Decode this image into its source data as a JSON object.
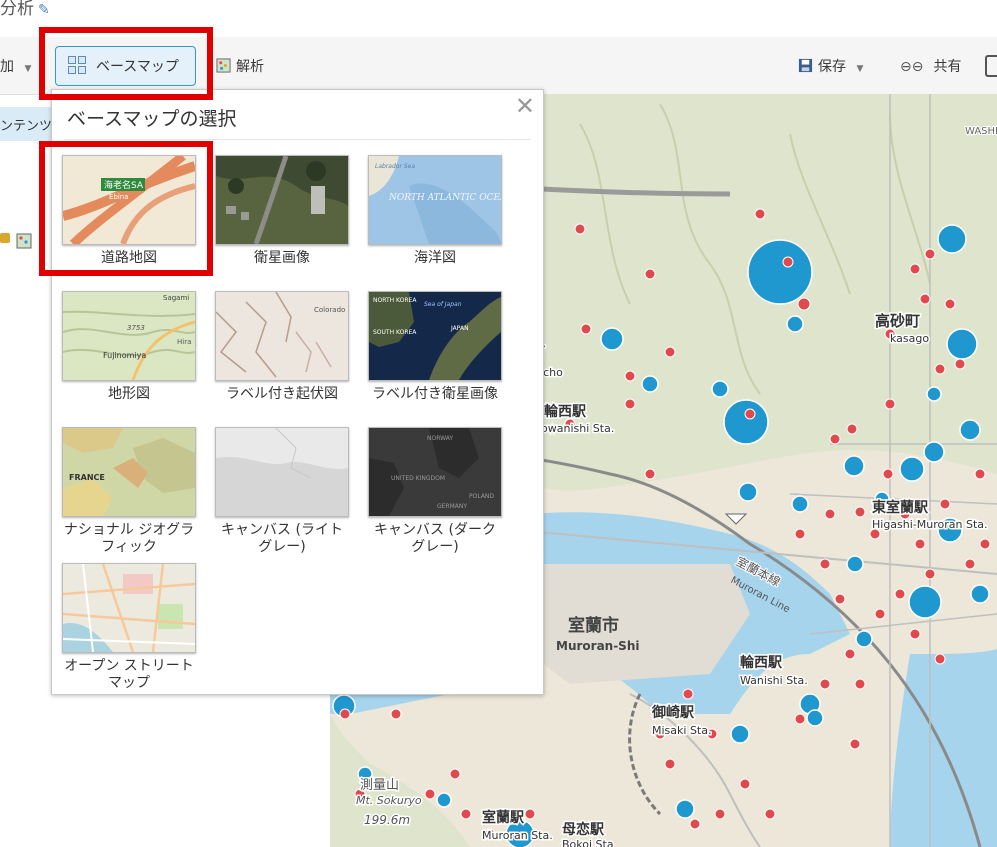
{
  "header": {
    "title": "分析",
    "edit_icon": "pencil-icon"
  },
  "toolbar": {
    "add_label": "加",
    "basemap_label": "ベースマップ",
    "analysis_label": "解析",
    "save_label": "保存",
    "share_label": "共有"
  },
  "left_panel": {
    "contents_label": "ンテンツ"
  },
  "basemap_panel": {
    "title": "ベースマップの選択",
    "close_icon": "close-icon",
    "items": [
      {
        "label": "道路地図",
        "thumb_label": "海老名SA",
        "thumb_sub": "Ebina"
      },
      {
        "label": "衛星画像"
      },
      {
        "label": "海洋図",
        "thumb_label": "NORTH ATLANTIC OCEAN",
        "thumb_sub": "Labrador Sea"
      },
      {
        "label": "地形図",
        "thumb_label": "Fujinomiya",
        "thumb_sub": "Sagami",
        "thumb_extra": "3753",
        "thumb_side": "Hira"
      },
      {
        "label": "ラベル付き起伏図",
        "thumb_label": "Colorado Springs"
      },
      {
        "label": "ラベル付き衛星画像",
        "thumb_label": "NORTH KOREA",
        "thumb_sub": "SOUTH KOREA",
        "thumb_extra": "JAPAN",
        "thumb_side": "Sea of Japan"
      },
      {
        "label": "ナショナル ジオグラフィック",
        "thumb_label": "FRANCE"
      },
      {
        "label": "キャンバス (ライト グレー)"
      },
      {
        "label": "キャンバス (ダーク グレー)",
        "thumb_label": "UNITED KINGDOM",
        "thumb_sub": "NORWAY",
        "thumb_extra": "GERMANY",
        "thumb_side": "POLAND"
      },
      {
        "label": "オープン ストリート マップ"
      }
    ]
  },
  "map": {
    "labels": {
      "town1": "町",
      "town1_en": "ihicho",
      "higashi_sta": "東室蘭駅",
      "higashi_sta_en": "Higashi-Muroran Sta.",
      "line_jp": "室蘭本線",
      "line_en": "Muroran Line",
      "city_jp": "室蘭市",
      "city_en": "Muroran-Shi",
      "wanishi_jp": "輪西駅",
      "wanishi_en": "Wanishi Sta.",
      "misaki_jp": "御崎駅",
      "misaki_en": "Misaki Sta.",
      "bokoi_jp": "母恋駅",
      "bokoi_en": "Bokoi Sta",
      "muroran_sta_jp": "室蘭駅",
      "muroran_sta_en": "Muroran Sta.",
      "mt_jp": "測量山",
      "mt_en": "Mt. Sokuryo",
      "mt_elev": "199.6m",
      "nishi_sta": "本輪西駅",
      "nishi_sta_en": "otowanishi Sta.",
      "takasago_jp": "高砂町",
      "takasago_en": "kasago",
      "washi": "WASHI"
    },
    "colors": {
      "blue": "#1f97cf",
      "red": "#e04a4f"
    }
  }
}
